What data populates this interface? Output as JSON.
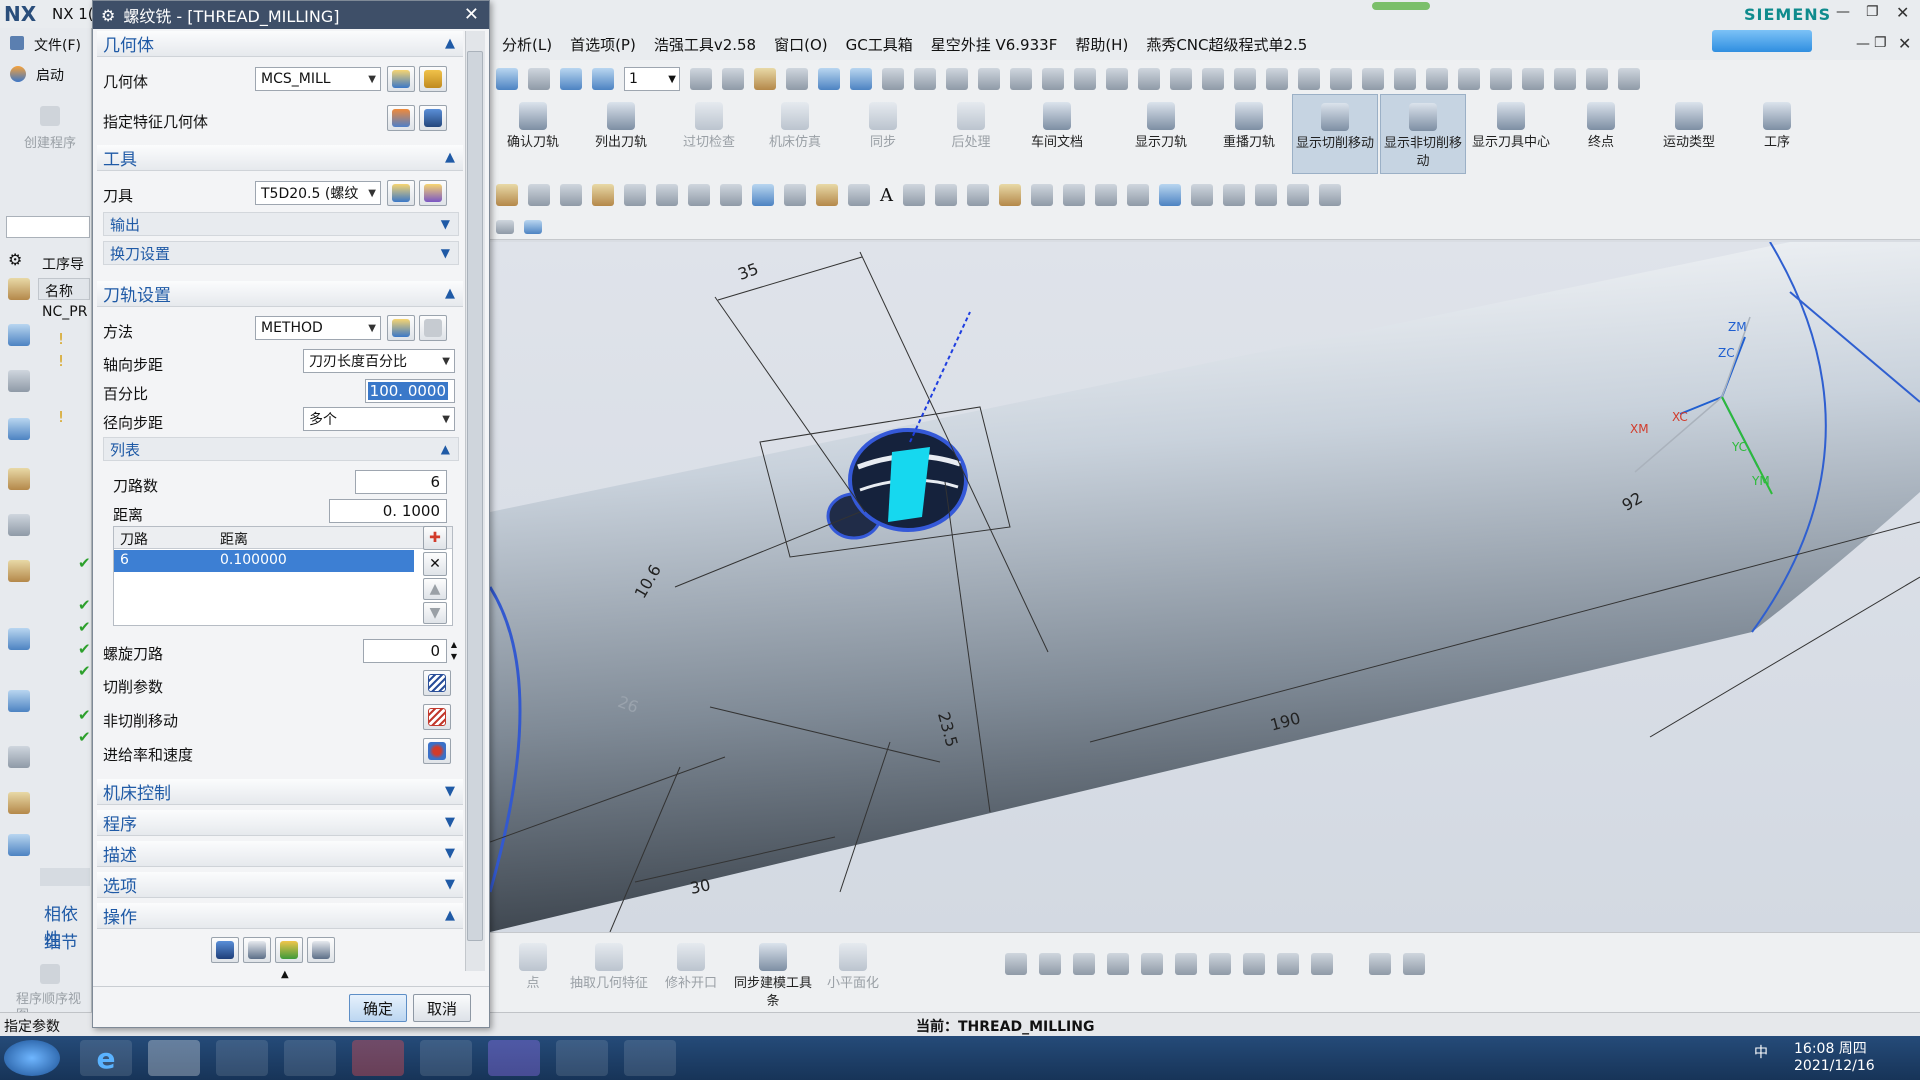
{
  "app": {
    "nx_logo": "NX",
    "title_short": "NX 1(",
    "brand": "SIEMENS"
  },
  "menubar": {
    "items": [
      "分析(L)",
      "首选项(P)",
      "浩强工具v2.58",
      "窗口(O)",
      "GC工具箱",
      "星空外挂 V6.933F",
      "帮助(H)",
      "燕秀CNC超级程式单2.5"
    ]
  },
  "leftstrip": {
    "file_menu": "文件(F)",
    "start_menu": "启动",
    "create_program": "创建程序",
    "nav_title": "工序导",
    "col_name": "名称",
    "root_node": "NC_PR",
    "related": "相依性",
    "details": "细节",
    "program_seq": "程序顺序视图"
  },
  "ribbon": {
    "tb_value": "1",
    "buttons": [
      {
        "label": "确认刀轨",
        "enabled": true
      },
      {
        "label": "列出刀轨",
        "enabled": true
      },
      {
        "label": "过切检查",
        "enabled": false
      },
      {
        "label": "机床仿真",
        "enabled": false
      },
      {
        "label": "同步",
        "enabled": false
      },
      {
        "label": "后处理",
        "enabled": false
      },
      {
        "label": "车间文档",
        "enabled": true
      },
      {
        "label": "显示刀轨",
        "enabled": true
      },
      {
        "label": "重播刀轨",
        "enabled": true
      },
      {
        "label": "显示切削移动",
        "enabled": true,
        "active": true
      },
      {
        "label": "显示非切削移动",
        "enabled": true,
        "active": true
      },
      {
        "label": "显示刀具中心",
        "enabled": true
      },
      {
        "label": "终点",
        "enabled": true
      },
      {
        "label": "运动类型",
        "enabled": true
      },
      {
        "label": "工序",
        "enabled": true
      }
    ]
  },
  "dialog": {
    "title": "螺纹铣 - [THREAD_MILLING]",
    "geometry": {
      "header": "几何体",
      "geometry_label": "几何体",
      "geometry_value": "MCS_MILL",
      "feature_label": "指定特征几何体"
    },
    "tool": {
      "header": "工具",
      "tool_label": "刀具",
      "tool_value": "T5D20.5 (螺纹",
      "output": "输出",
      "tool_change": "换刀设置"
    },
    "path": {
      "header": "刀轨设置",
      "method_label": "方法",
      "method_value": "METHOD",
      "axial_label": "轴向步距",
      "axial_value": "刀刃长度百分比",
      "percent_label": "百分比",
      "percent_value": "100. 0000",
      "radial_label": "径向步距",
      "radial_value": "多个",
      "list_header": "列表",
      "paths_label": "刀路数",
      "paths_value": "6",
      "distance_label": "距离",
      "distance_value": "0. 1000",
      "table_headers": [
        "刀路",
        "距离"
      ],
      "table_rows": [
        [
          "6",
          "0.100000"
        ]
      ],
      "spiral_label": "螺旋刀路",
      "spiral_value": "0",
      "cut_params": "切削参数",
      "non_cut": "非切削移动",
      "feeds": "进给率和速度"
    },
    "sections": {
      "machine": "机床控制",
      "program": "程序",
      "description": "描述",
      "options": "选项",
      "operation": "操作"
    },
    "ok": "确定",
    "cancel": "取消"
  },
  "viewport": {
    "dims": [
      "35",
      "10.6",
      "26",
      "23.5",
      "190",
      "30",
      "92"
    ],
    "axes": [
      "ZM",
      "ZC",
      "XM",
      "XC",
      "YC",
      "YM"
    ]
  },
  "bottombar": {
    "buttons": [
      {
        "label": "点",
        "enabled": false
      },
      {
        "label": "抽取几何特征",
        "enabled": false
      },
      {
        "label": "修补开口",
        "enabled": false
      },
      {
        "label": "同步建模工具条",
        "enabled": true
      },
      {
        "label": "小平面化",
        "enabled": false
      }
    ]
  },
  "status": {
    "left": "指定参数",
    "current": "当前：THREAD_MILLING"
  },
  "taskbar": {
    "time": "16:08 周四",
    "date": "2021/12/16",
    "ime": "中"
  },
  "colors": {
    "dialog_title": "#3e4f68",
    "section_text": "#1f5aa6",
    "selection": "#3d7fd3",
    "taskbar": "#1e4168"
  }
}
